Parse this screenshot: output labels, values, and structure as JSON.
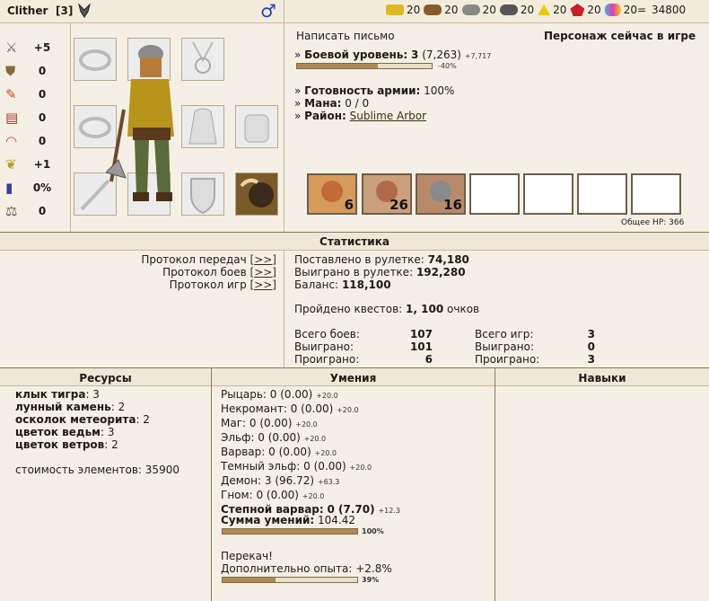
{
  "header": {
    "name": "Clither",
    "level_badge": "[3]",
    "gender_icon": "male-icon",
    "resources": [
      {
        "icon": "gold-icon",
        "value": "20"
      },
      {
        "icon": "wood-icon",
        "value": "20"
      },
      {
        "icon": "ore-icon",
        "value": "20"
      },
      {
        "icon": "mercury-icon",
        "value": "20"
      },
      {
        "icon": "sulfur-icon",
        "value": "20"
      },
      {
        "icon": "crystal-icon",
        "value": "20"
      },
      {
        "icon": "gems-icon",
        "value": "20="
      }
    ],
    "total": "34800"
  },
  "stats_left": [
    {
      "icon": "attack-icon",
      "value": "+5"
    },
    {
      "icon": "defense-icon",
      "value": "0"
    },
    {
      "icon": "spellpower-icon",
      "value": "0"
    },
    {
      "icon": "knowledge-icon",
      "value": "0"
    },
    {
      "icon": "luck-icon",
      "value": "0"
    },
    {
      "icon": "morale-icon",
      "value": "+1"
    },
    {
      "icon": "mana-icon",
      "value": "0%"
    },
    {
      "icon": "initiative-icon",
      "value": "0"
    }
  ],
  "info": {
    "write_letter": "Написать письмо",
    "online": "Персонаж сейчас в игре",
    "combat_level_label": "Боевой уровень:",
    "combat_level_value": "3",
    "combat_exp": "(7,263)",
    "combat_exp_next": "+7,717",
    "combat_bar_percent": 60,
    "combat_bar_text": "-40%",
    "army_ready_label": "Готовность армии:",
    "army_ready_value": "100%",
    "mana_label": "Мана:",
    "mana_value": "0 / 0",
    "district_label": "Район:",
    "district_value": "Sublime Arbor",
    "army": [
      {
        "count": "6"
      },
      {
        "count": "26"
      },
      {
        "count": "16"
      },
      {
        "count": ""
      },
      {
        "count": ""
      },
      {
        "count": ""
      },
      {
        "count": ""
      }
    ],
    "total_hp": "Общее HP: 366"
  },
  "statistics": {
    "title": "Статистика",
    "links": [
      {
        "label": "Протокол передач",
        "link": "[>>]"
      },
      {
        "label": "Протокол боев",
        "link": "[>>]"
      },
      {
        "label": "Протокол игр",
        "link": "[>>]"
      }
    ],
    "roulette_bet_label": "Поставлено в рулетке:",
    "roulette_bet_value": "74,180",
    "roulette_win_label": "Выиграно в рулетке:",
    "roulette_win_value": "192,280",
    "balance_label": "Баланс:",
    "balance_value": "118,100",
    "quests_label": "Пройдено квестов:",
    "quests_value": "1, 100",
    "quests_suffix": "очков",
    "battles_total_label": "Всего боев:",
    "battles_total_value": "107",
    "battles_won_label": "Выиграно:",
    "battles_won_value": "101",
    "battles_lost_label": "Проиграно:",
    "battles_lost_value": "6",
    "games_total_label": "Всего игр:",
    "games_total_value": "3",
    "games_won_label": "Выиграно:",
    "games_won_value": "0",
    "games_lost_label": "Проиграно:",
    "games_lost_value": "3"
  },
  "resources_panel": {
    "title": "Ресурсы",
    "items": [
      {
        "name": "клык тигра",
        "value": "3"
      },
      {
        "name": "лунный камень",
        "value": "2"
      },
      {
        "name": "осколок метеорита",
        "value": "2"
      },
      {
        "name": "цветок ведьм",
        "value": "3"
      },
      {
        "name": "цветок ветров",
        "value": "2"
      }
    ],
    "cost_label": "стоимость элементов:",
    "cost_value": "35900"
  },
  "skills_panel": {
    "title": "Умения",
    "items": [
      {
        "name": "Рыцарь:",
        "value": "0 (0.00)",
        "extra": "+20.0"
      },
      {
        "name": "Некромант:",
        "value": "0 (0.00)",
        "extra": "+20.0"
      },
      {
        "name": "Маг:",
        "value": "0 (0.00)",
        "extra": "+20.0"
      },
      {
        "name": "Эльф:",
        "value": "0 (0.00)",
        "extra": "+20.0"
      },
      {
        "name": "Варвар:",
        "value": "0 (0.00)",
        "extra": "+20.0"
      },
      {
        "name": "Темный эльф:",
        "value": "0 (0.00)",
        "extra": "+20.0"
      },
      {
        "name": "Демон:",
        "value": "3 (96.72)",
        "extra": "+63.3"
      },
      {
        "name": "Гном:",
        "value": "0 (0.00)",
        "extra": "+20.0"
      },
      {
        "name": "Степной варвар:",
        "value": "0 (7.70)",
        "extra": "+12.3"
      }
    ],
    "sum_label": "Сумма умений:",
    "sum_value": "104.42",
    "sum_bar_percent": 100,
    "sum_bar_text": "100%",
    "overflow_label": "Перекач!",
    "extra_exp_label": "Дополнительно опыта:",
    "extra_exp_value": "+2.8%",
    "exp_bar_percent": 39,
    "exp_bar_text": "39%"
  },
  "talents_panel": {
    "title": "Навыки"
  }
}
